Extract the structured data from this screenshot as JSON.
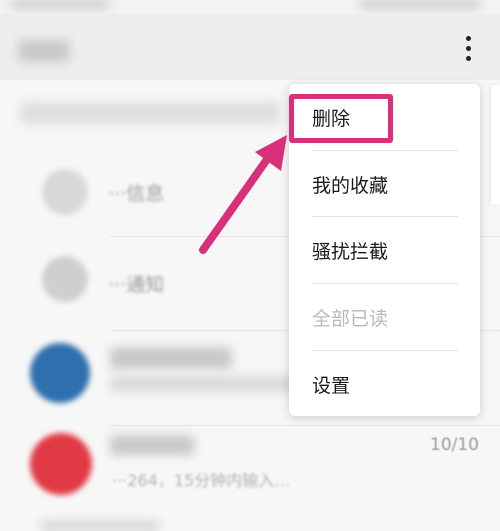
{
  "header": {
    "more_icon": "more-vert-icon"
  },
  "conversations": [
    {
      "title": "···信息",
      "subtitle": "",
      "time": "",
      "avatar_color": "#d8d8d8"
    },
    {
      "title": "···通知",
      "subtitle": "",
      "time": "",
      "avatar_color": "#cfcfcf"
    },
    {
      "title": "",
      "subtitle": "",
      "time": "",
      "avatar_color": "#2f6fae"
    },
    {
      "title": "",
      "subtitle": "···264，15分钟内输入…",
      "time": "10/10",
      "avatar_color": "#e23a45"
    }
  ],
  "menu": {
    "items": [
      {
        "label": "删除",
        "enabled": true
      },
      {
        "label": "我的收藏",
        "enabled": true
      },
      {
        "label": "骚扰拦截",
        "enabled": true
      },
      {
        "label": "全部已读",
        "enabled": false
      },
      {
        "label": "设置",
        "enabled": true
      }
    ]
  },
  "annotation": {
    "highlight_color": "#d9307b"
  }
}
